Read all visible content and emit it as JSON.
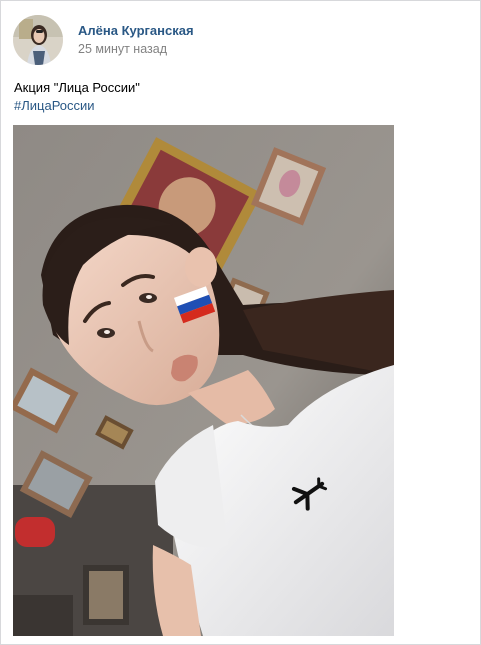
{
  "post": {
    "author": {
      "name": "Алёна Курганская",
      "avatar_icon": "user-avatar"
    },
    "time": "25 минут назад",
    "text": "Акция \"Лица России\"",
    "hashtag": "#ЛицаРоссии",
    "photo": {
      "kind": "selfie-photo",
      "accent_colors": {
        "flag_white": "#ffffff",
        "flag_blue": "#1f4fb4",
        "flag_red": "#d52b1e",
        "shirt": "#f4f4f4",
        "wall": "#8a8580"
      }
    }
  }
}
